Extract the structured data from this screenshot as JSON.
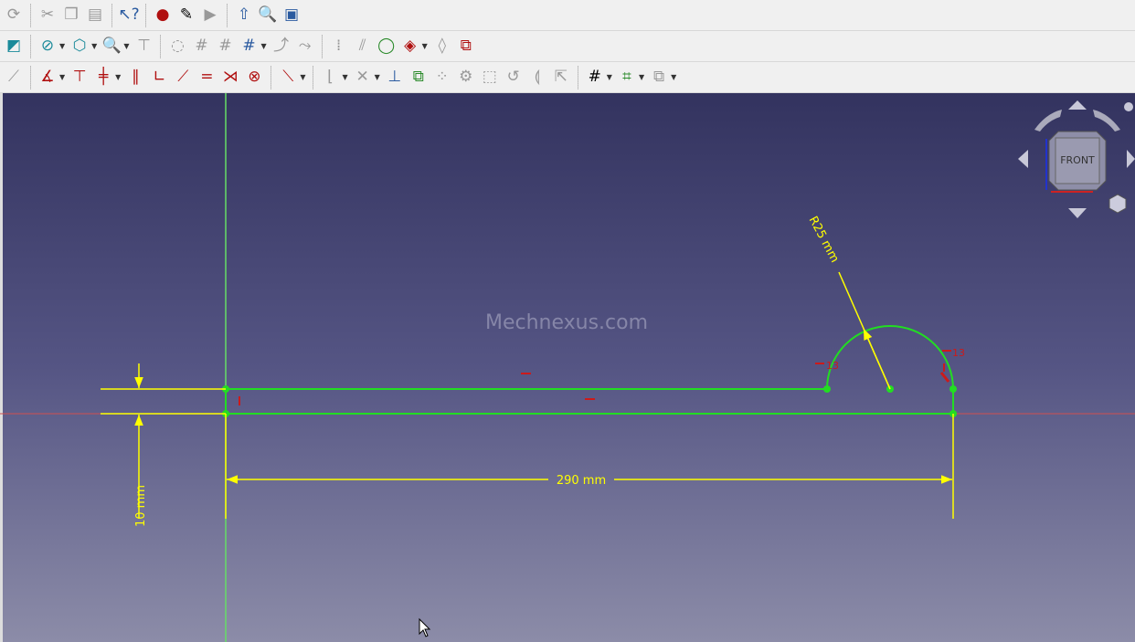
{
  "toolbar1": [
    {
      "icon": "refresh-icon",
      "g": "⟳",
      "c": "gray"
    },
    "sep",
    {
      "icon": "cut-icon",
      "g": "✂",
      "c": "gray"
    },
    {
      "icon": "copy-icon",
      "g": "❐",
      "c": "gray"
    },
    {
      "icon": "paste-icon",
      "g": "▤",
      "c": "gray"
    },
    "sep",
    {
      "icon": "whats-this-icon",
      "g": "↖?",
      "c": "blue"
    },
    "sep",
    {
      "icon": "macro-record-icon",
      "g": "●",
      "c": "red"
    },
    {
      "icon": "macro-edit-icon",
      "g": "✎",
      "c": ""
    },
    {
      "icon": "macro-run-icon",
      "g": "▶",
      "c": "gray"
    },
    "sep",
    {
      "icon": "leave-sketch-icon",
      "g": "⇧",
      "c": "blue"
    },
    {
      "icon": "view-sketch-icon",
      "g": "🔍",
      "c": "red"
    },
    {
      "icon": "view-section-icon",
      "g": "▣",
      "c": "blue"
    }
  ],
  "toolbar2": [
    {
      "icon": "sketch-icon",
      "g": "◩",
      "c": "teal"
    },
    "sep",
    {
      "icon": "draw-style-icon",
      "g": "⊘",
      "c": "teal",
      "dd": 1
    },
    {
      "icon": "std-view-icon",
      "g": "⬡",
      "c": "teal",
      "dd": 1
    },
    {
      "icon": "zoom-icon",
      "g": "🔍",
      "c": "teal",
      "dd": 1
    },
    {
      "icon": "measure-icon",
      "g": "⊤",
      "c": "gray"
    },
    "sep",
    {
      "icon": "close-shape-icon",
      "g": "◌",
      "c": "gray"
    },
    {
      "icon": "connect-edges-icon",
      "g": "#",
      "c": "gray"
    },
    {
      "icon": "select-constraints-icon",
      "g": "#",
      "c": "gray"
    },
    {
      "icon": "select-origin-icon",
      "g": "#",
      "c": "blue",
      "dd": 1
    },
    {
      "icon": "select-conflicting-icon",
      "g": "⤴",
      "c": "gray"
    },
    {
      "icon": "select-redundant-icon",
      "g": "⤳",
      "c": "gray"
    },
    "sep",
    {
      "icon": "restore-internal-icon",
      "g": "⁞",
      "c": "gray"
    },
    {
      "icon": "symmetry-icon",
      "g": "⫽",
      "c": "gray"
    },
    {
      "icon": "bspline-icon",
      "g": "◯",
      "c": "green"
    },
    {
      "icon": "bspline-degree-icon",
      "g": "◈",
      "c": "red",
      "dd": 1
    },
    {
      "icon": "bspline-knot-icon",
      "g": "◊",
      "c": "gray"
    },
    {
      "icon": "copy-clone-icon",
      "g": "⧉",
      "c": "red"
    }
  ],
  "toolbar3": [
    {
      "icon": "construction-mode-icon",
      "g": "⟋",
      "c": "gray",
      "dd0": 1
    },
    "sep",
    {
      "icon": "constrain-lock-icon",
      "g": "∡",
      "c": "red",
      "dd": 1
    },
    {
      "icon": "vertical-distance-icon",
      "g": "⊤",
      "c": "red"
    },
    {
      "icon": "horizontal-distance-icon",
      "g": "╪",
      "c": "red",
      "dd": 1
    },
    {
      "icon": "parallel-icon",
      "g": "∥",
      "c": "red"
    },
    {
      "icon": "perpendicular-icon",
      "g": "∟",
      "c": "red"
    },
    {
      "icon": "tangent-icon",
      "g": "⟋",
      "c": "red"
    },
    {
      "icon": "equal-icon",
      "g": "=",
      "c": "red"
    },
    {
      "icon": "symmetric-icon",
      "g": "⋊",
      "c": "red"
    },
    {
      "icon": "block-icon",
      "g": "⊗",
      "c": "red"
    },
    "sep",
    {
      "icon": "toggle-driving-icon",
      "g": "⟍",
      "c": "red",
      "dd": 1
    },
    "sep",
    {
      "icon": "fillet-icon",
      "g": "⌊",
      "c": "gray",
      "dd": 1
    },
    {
      "icon": "trim-icon",
      "g": "✕",
      "c": "gray",
      "dd": 1
    },
    {
      "icon": "external-geometry-icon",
      "g": "⊥",
      "c": "blue"
    },
    {
      "icon": "carbon-copy-icon",
      "g": "⧉",
      "c": "green"
    },
    {
      "icon": "select-points-icon",
      "g": "⁘",
      "c": "gray"
    },
    {
      "icon": "rotate-icon",
      "g": "⚙",
      "c": "gray"
    },
    {
      "icon": "scale-icon",
      "g": "⬚",
      "c": "gray"
    },
    {
      "icon": "offset-icon",
      "g": "↺",
      "c": "gray"
    },
    {
      "icon": "mirror-icon",
      "g": "⟬",
      "c": "gray"
    },
    {
      "icon": "move-icon",
      "g": "⇱",
      "c": "gray"
    },
    "sep",
    {
      "icon": "grid-icon",
      "g": "#",
      "c": "",
      "dd": 1
    },
    {
      "icon": "snap-icon",
      "g": "⌗",
      "c": "green",
      "dd": 1
    },
    {
      "icon": "render-order-icon",
      "g": "⧉",
      "c": "gray",
      "dd": 1
    }
  ],
  "viewport": {
    "watermark": "Mechnexus.com",
    "navcube_face": "FRONT"
  },
  "sketch": {
    "dims": {
      "width": "290 mm",
      "height": "10 mm",
      "radius": "R25 mm"
    },
    "constraint_labels": {
      "tangent_left": "13",
      "tangent_right": "13"
    },
    "colors": {
      "geometry": "#22dd22",
      "dimension": "#ffff00",
      "constraint": "#cc1a1a",
      "x_axis": "#d05050",
      "y_axis": "#66dd66"
    }
  }
}
